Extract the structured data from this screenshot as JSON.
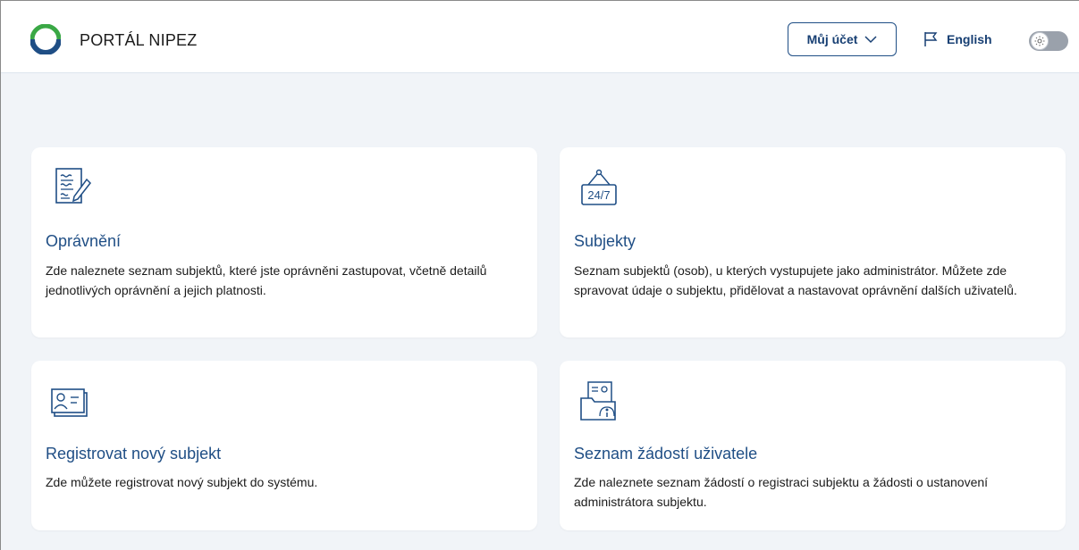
{
  "header": {
    "brand": "PORTÁL NIPEZ",
    "logo_icon": "nipez-logo-icon",
    "account_label": "Můj účet",
    "account_icon": "chevron-down-icon",
    "language_label": "English",
    "language_icon": "flag-icon",
    "theme_toggle_icon": "sun-icon"
  },
  "cards": [
    {
      "icon": "document-edit-icon",
      "title": "Oprávnění",
      "description": "Zde naleznete seznam subjektů, které jste oprávněni zastupovat, včetně detailů jednotlivých oprávnění a jejich platnosti."
    },
    {
      "icon": "24-7-sign-icon",
      "icon_text": "24/7",
      "title": "Subjekty",
      "description": "Seznam subjektů (osob), u kterých vystupujete jako administrátor. Můžete zde spravovat údaje o subjektu, přidělovat a nastavovat oprávnění dalších uživatelů."
    },
    {
      "icon": "id-card-icon",
      "title": "Registrovat nový subjekt",
      "description": "Zde můžete registrovat nový subjekt do systému."
    },
    {
      "icon": "folder-profile-icon",
      "title": "Seznam žádostí uživatele",
      "description": "Zde naleznete seznam žádostí o registraci subjektu a žádosti o ustanovení administrátora subjektu."
    }
  ],
  "colors": {
    "background": "#f1f4f8",
    "primary": "#1f4e85",
    "logo_green": "#3aa845",
    "logo_blue": "#1f4e85"
  }
}
